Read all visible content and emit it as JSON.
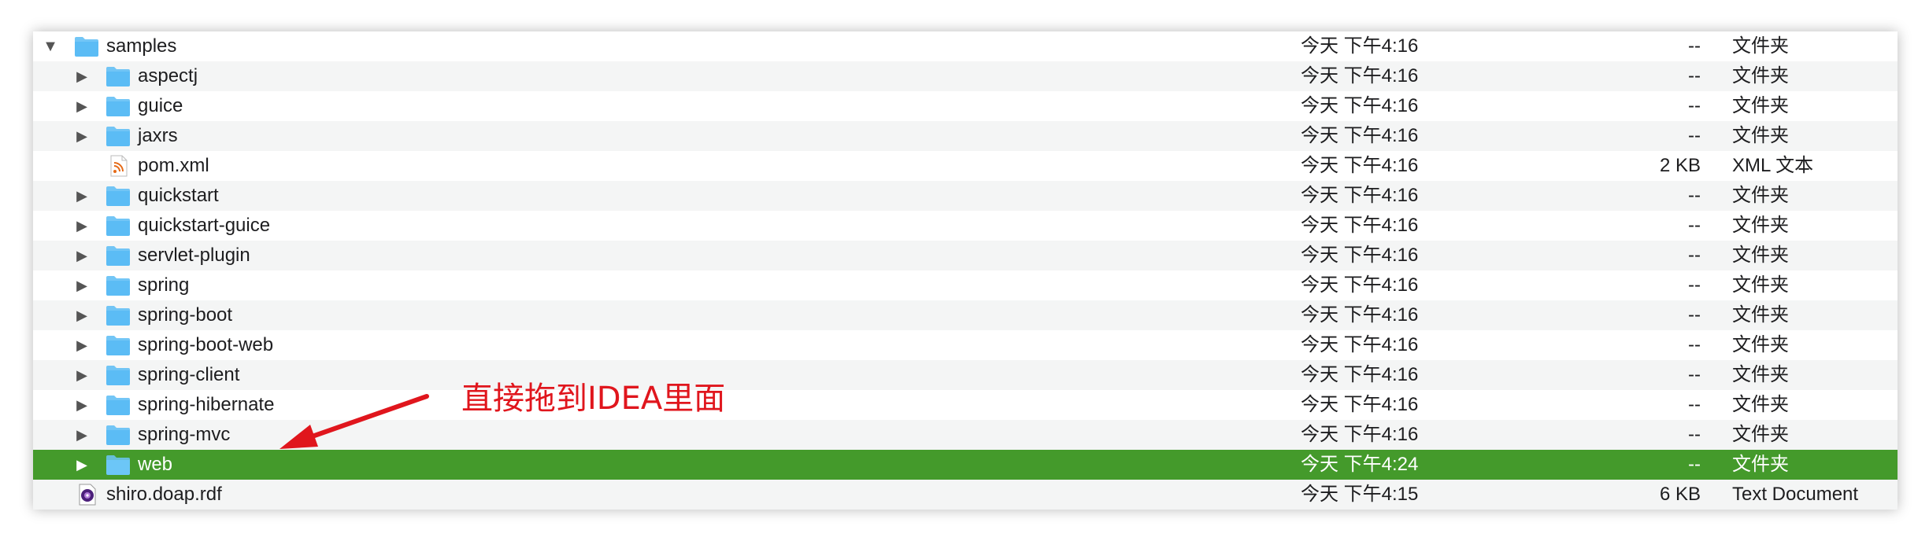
{
  "files": [
    {
      "name": "samples",
      "date": "今天 下午4:16",
      "size": "--",
      "kind": "文件夹",
      "icon": "folder-icon",
      "disclosure": "open",
      "level": 0
    },
    {
      "name": "aspectj",
      "date": "今天 下午4:16",
      "size": "--",
      "kind": "文件夹",
      "icon": "folder-icon",
      "disclosure": "closed",
      "level": 1
    },
    {
      "name": "guice",
      "date": "今天 下午4:16",
      "size": "--",
      "kind": "文件夹",
      "icon": "folder-icon",
      "disclosure": "closed",
      "level": 1
    },
    {
      "name": "jaxrs",
      "date": "今天 下午4:16",
      "size": "--",
      "kind": "文件夹",
      "icon": "folder-icon",
      "disclosure": "closed",
      "level": 1
    },
    {
      "name": "pom.xml",
      "date": "今天 下午4:16",
      "size": "2 KB",
      "kind": "XML 文本",
      "icon": "xml-file-icon",
      "disclosure": "none",
      "level": 1
    },
    {
      "name": "quickstart",
      "date": "今天 下午4:16",
      "size": "--",
      "kind": "文件夹",
      "icon": "folder-icon",
      "disclosure": "closed",
      "level": 1
    },
    {
      "name": "quickstart-guice",
      "date": "今天 下午4:16",
      "size": "--",
      "kind": "文件夹",
      "icon": "folder-icon",
      "disclosure": "closed",
      "level": 1
    },
    {
      "name": "servlet-plugin",
      "date": "今天 下午4:16",
      "size": "--",
      "kind": "文件夹",
      "icon": "folder-icon",
      "disclosure": "closed",
      "level": 1
    },
    {
      "name": "spring",
      "date": "今天 下午4:16",
      "size": "--",
      "kind": "文件夹",
      "icon": "folder-icon",
      "disclosure": "closed",
      "level": 1
    },
    {
      "name": "spring-boot",
      "date": "今天 下午4:16",
      "size": "--",
      "kind": "文件夹",
      "icon": "folder-icon",
      "disclosure": "closed",
      "level": 1
    },
    {
      "name": "spring-boot-web",
      "date": "今天 下午4:16",
      "size": "--",
      "kind": "文件夹",
      "icon": "folder-icon",
      "disclosure": "closed",
      "level": 1
    },
    {
      "name": "spring-client",
      "date": "今天 下午4:16",
      "size": "--",
      "kind": "文件夹",
      "icon": "folder-icon",
      "disclosure": "closed",
      "level": 1
    },
    {
      "name": "spring-hibernate",
      "date": "今天 下午4:16",
      "size": "--",
      "kind": "文件夹",
      "icon": "folder-icon",
      "disclosure": "closed",
      "level": 1
    },
    {
      "name": "spring-mvc",
      "date": "今天 下午4:16",
      "size": "--",
      "kind": "文件夹",
      "icon": "folder-icon",
      "disclosure": "closed",
      "level": 1
    },
    {
      "name": "web",
      "date": "今天 下午4:24",
      "size": "--",
      "kind": "文件夹",
      "icon": "folder-icon",
      "disclosure": "closed",
      "level": 1,
      "selected": true
    },
    {
      "name": "shiro.doap.rdf",
      "date": "今天 下午4:15",
      "size": "6 KB",
      "kind": "Text Document",
      "icon": "rdf-file-icon",
      "disclosure": "none",
      "level": 0
    }
  ],
  "annotation": {
    "text": "直接拖到IDEA里面",
    "color": "#e0161d"
  },
  "colors": {
    "selection": "#449a2b",
    "folder": "#5bbcf5",
    "alt_row": "#f4f5f5"
  }
}
